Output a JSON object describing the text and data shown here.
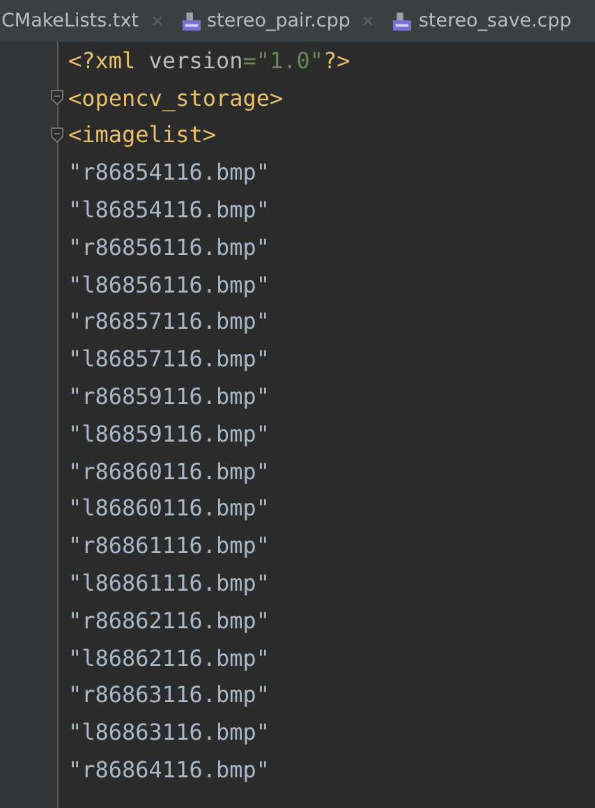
{
  "tabs": [
    {
      "label": "CMakeLists.txt",
      "kind": "text",
      "closable": true,
      "selected": false
    },
    {
      "label": "stereo_pair.cpp",
      "kind": "cpp",
      "closable": true,
      "selected": false
    },
    {
      "label": "stereo_save.cpp",
      "kind": "cpp",
      "closable": false,
      "selected": false
    }
  ],
  "editor": {
    "lines": [
      {
        "foldable": false,
        "tokens": [
          {
            "text": "<?xml ",
            "kind": "tag"
          },
          {
            "text": "version",
            "kind": "attr"
          },
          {
            "text": "=\"1.0\"",
            "kind": "value"
          },
          {
            "text": "?>",
            "kind": "tag"
          }
        ]
      },
      {
        "foldable": true,
        "tokens": [
          {
            "text": "<opencv_storage>",
            "kind": "tag"
          }
        ]
      },
      {
        "foldable": true,
        "tokens": [
          {
            "text": "<imagelist>",
            "kind": "tag"
          }
        ]
      },
      {
        "foldable": false,
        "tokens": [
          {
            "text": "\"r86854116.bmp\"",
            "kind": "text"
          }
        ]
      },
      {
        "foldable": false,
        "tokens": [
          {
            "text": "\"l86854116.bmp\"",
            "kind": "text"
          }
        ]
      },
      {
        "foldable": false,
        "tokens": [
          {
            "text": "\"r86856116.bmp\"",
            "kind": "text"
          }
        ]
      },
      {
        "foldable": false,
        "tokens": [
          {
            "text": "\"l86856116.bmp\"",
            "kind": "text"
          }
        ]
      },
      {
        "foldable": false,
        "tokens": [
          {
            "text": "\"r86857116.bmp\"",
            "kind": "text"
          }
        ]
      },
      {
        "foldable": false,
        "tokens": [
          {
            "text": "\"l86857116.bmp\"",
            "kind": "text"
          }
        ]
      },
      {
        "foldable": false,
        "tokens": [
          {
            "text": "\"r86859116.bmp\"",
            "kind": "text"
          }
        ]
      },
      {
        "foldable": false,
        "tokens": [
          {
            "text": "\"l86859116.bmp\"",
            "kind": "text"
          }
        ]
      },
      {
        "foldable": false,
        "tokens": [
          {
            "text": "\"r86860116.bmp\"",
            "kind": "text"
          }
        ]
      },
      {
        "foldable": false,
        "tokens": [
          {
            "text": "\"l86860116.bmp\"",
            "kind": "text"
          }
        ]
      },
      {
        "foldable": false,
        "tokens": [
          {
            "text": "\"r86861116.bmp\"",
            "kind": "text"
          }
        ]
      },
      {
        "foldable": false,
        "tokens": [
          {
            "text": "\"l86861116.bmp\"",
            "kind": "text"
          }
        ]
      },
      {
        "foldable": false,
        "tokens": [
          {
            "text": "\"r86862116.bmp\"",
            "kind": "text"
          }
        ]
      },
      {
        "foldable": false,
        "tokens": [
          {
            "text": "\"l86862116.bmp\"",
            "kind": "text"
          }
        ]
      },
      {
        "foldable": false,
        "tokens": [
          {
            "text": "\"r86863116.bmp\"",
            "kind": "text"
          }
        ]
      },
      {
        "foldable": false,
        "tokens": [
          {
            "text": "\"l86863116.bmp\"",
            "kind": "text"
          }
        ]
      },
      {
        "foldable": false,
        "tokens": [
          {
            "text": "\"r86864116.bmp\"",
            "kind": "text"
          }
        ]
      }
    ]
  }
}
